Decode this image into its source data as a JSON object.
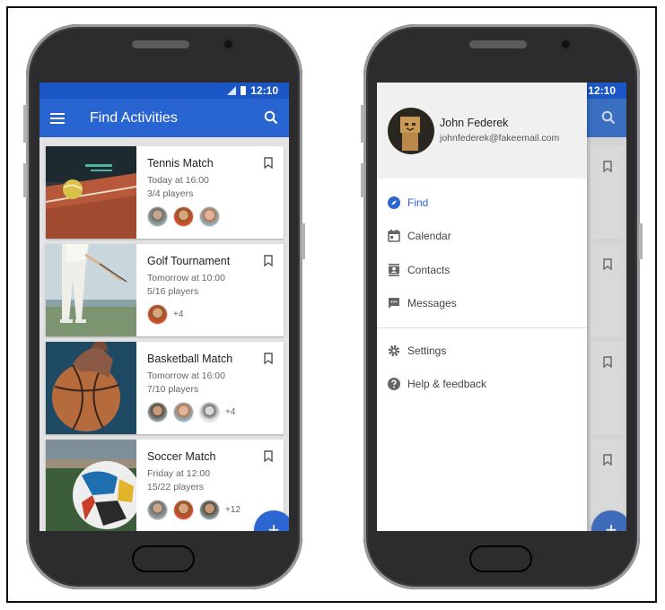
{
  "left": {
    "status_time": "12:10",
    "app_title": "Find Activities",
    "cards": [
      {
        "title": "Tennis Match",
        "when": "Today at 16:00",
        "players": "3/4 players",
        "more": ""
      },
      {
        "title": "Golf Tournament",
        "when": "Tomorrow at 10:00",
        "players": "5/16 players",
        "more": "+4"
      },
      {
        "title": "Basketball Match",
        "when": "Tomorrow at 16:00",
        "players": "7/10 players",
        "more": "+4"
      },
      {
        "title": "Soccer Match",
        "when": "Friday at 12:00",
        "players": "15/22 players",
        "more": "+12"
      }
    ],
    "fab_label": "+"
  },
  "right": {
    "status_time": "12:10",
    "user_name": "John Federek",
    "user_email": "johnfederek@fakeemail.com",
    "menu": [
      {
        "label": "Find",
        "icon": "compass-icon",
        "active": true
      },
      {
        "label": "Calendar",
        "icon": "calendar-icon",
        "active": false
      },
      {
        "label": "Contacts",
        "icon": "contacts-icon",
        "active": false
      },
      {
        "label": "Messages",
        "icon": "message-icon",
        "active": false
      }
    ],
    "menu_secondary": [
      {
        "label": "Settings",
        "icon": "gear-icon"
      },
      {
        "label": "Help & feedback",
        "icon": "help-icon"
      }
    ],
    "fab_label": "+"
  },
  "colors": {
    "primary": "#2965d1",
    "status": "#1a56c4",
    "active": "#2b66d1"
  }
}
